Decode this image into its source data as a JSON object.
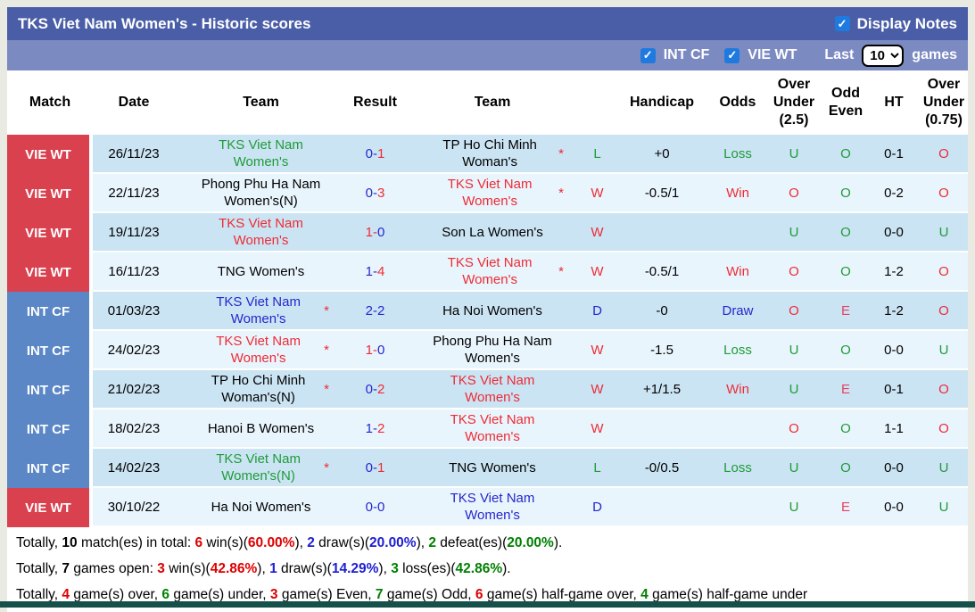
{
  "header": {
    "title": "TKS Viet Nam Women's - Historic scores",
    "display_notes_label": "Display Notes",
    "display_notes_checked": true,
    "filters": [
      {
        "label": "INT CF",
        "checked": true
      },
      {
        "label": "VIE WT",
        "checked": true
      }
    ],
    "last_label": "Last",
    "last_value": "10",
    "games_label": "games"
  },
  "table": {
    "columns": [
      "Match",
      "Date",
      "Team",
      "Result",
      "Team",
      "",
      "Handicap",
      "Odds",
      "Over Under (2.5)",
      "Odd Even",
      "HT",
      "Over Under (0.75)"
    ],
    "rows": [
      {
        "league": "VIE WT",
        "league_color": "red",
        "date": "26/11/23",
        "team1": {
          "name": "TKS Viet Nam Women's",
          "color": "green",
          "star": false
        },
        "result": {
          "home": "0",
          "away": "1",
          "home_color": "blue",
          "away_color": "red"
        },
        "team2": {
          "name": "TP Ho Chi Minh Woman's",
          "color": "black",
          "star": true
        },
        "outcome": {
          "value": "L",
          "color": "green"
        },
        "handicap": "+0",
        "odds": {
          "value": "Loss",
          "color": "green"
        },
        "over_under_25": {
          "value": "U",
          "color": "green"
        },
        "odd_even": {
          "value": "O",
          "color": "green"
        },
        "ht": "0-1",
        "over_under_075": {
          "value": "O",
          "color": "red"
        }
      },
      {
        "league": "VIE WT",
        "league_color": "red",
        "date": "22/11/23",
        "team1": {
          "name": "Phong Phu Ha Nam Women's(N)",
          "color": "black",
          "star": false
        },
        "result": {
          "home": "0",
          "away": "3",
          "home_color": "blue",
          "away_color": "red"
        },
        "team2": {
          "name": "TKS Viet Nam Women's",
          "color": "red",
          "star": true
        },
        "outcome": {
          "value": "W",
          "color": "red"
        },
        "handicap": "-0.5/1",
        "odds": {
          "value": "Win",
          "color": "red"
        },
        "over_under_25": {
          "value": "O",
          "color": "red"
        },
        "odd_even": {
          "value": "O",
          "color": "green"
        },
        "ht": "0-2",
        "over_under_075": {
          "value": "O",
          "color": "red"
        }
      },
      {
        "league": "VIE WT",
        "league_color": "red",
        "date": "19/11/23",
        "team1": {
          "name": "TKS Viet Nam Women's",
          "color": "red",
          "star": false
        },
        "result": {
          "home": "1",
          "away": "0",
          "home_color": "red",
          "away_color": "blue"
        },
        "team2": {
          "name": "Son La Women's",
          "color": "black",
          "star": false
        },
        "outcome": {
          "value": "W",
          "color": "red"
        },
        "handicap": "",
        "odds": {
          "value": "",
          "color": "black"
        },
        "over_under_25": {
          "value": "U",
          "color": "green"
        },
        "odd_even": {
          "value": "O",
          "color": "green"
        },
        "ht": "0-0",
        "over_under_075": {
          "value": "U",
          "color": "green"
        }
      },
      {
        "league": "VIE WT",
        "league_color": "red",
        "date": "16/11/23",
        "team1": {
          "name": "TNG Women's",
          "color": "black",
          "star": false
        },
        "result": {
          "home": "1",
          "away": "4",
          "home_color": "blue",
          "away_color": "red"
        },
        "team2": {
          "name": "TKS Viet Nam Women's",
          "color": "red",
          "star": true
        },
        "outcome": {
          "value": "W",
          "color": "red"
        },
        "handicap": "-0.5/1",
        "odds": {
          "value": "Win",
          "color": "red"
        },
        "over_under_25": {
          "value": "O",
          "color": "red"
        },
        "odd_even": {
          "value": "O",
          "color": "green"
        },
        "ht": "1-2",
        "over_under_075": {
          "value": "O",
          "color": "red"
        }
      },
      {
        "league": "INT CF",
        "league_color": "blue",
        "date": "01/03/23",
        "team1": {
          "name": "TKS Viet Nam Women's",
          "color": "blue",
          "star": true
        },
        "result": {
          "home": "2",
          "away": "2",
          "home_color": "blue",
          "away_color": "blue"
        },
        "team2": {
          "name": "Ha Noi Women's",
          "color": "black",
          "star": false
        },
        "outcome": {
          "value": "D",
          "color": "blue"
        },
        "handicap": "-0",
        "odds": {
          "value": "Draw",
          "color": "blue"
        },
        "over_under_25": {
          "value": "O",
          "color": "red"
        },
        "odd_even": {
          "value": "E",
          "color": "crimson"
        },
        "ht": "1-2",
        "over_under_075": {
          "value": "O",
          "color": "red"
        }
      },
      {
        "league": "INT CF",
        "league_color": "blue",
        "date": "24/02/23",
        "team1": {
          "name": "TKS Viet Nam Women's",
          "color": "red",
          "star": true
        },
        "result": {
          "home": "1",
          "away": "0",
          "home_color": "red",
          "away_color": "blue"
        },
        "team2": {
          "name": "Phong Phu Ha Nam Women's",
          "color": "black",
          "star": false
        },
        "outcome": {
          "value": "W",
          "color": "red"
        },
        "handicap": "-1.5",
        "odds": {
          "value": "Loss",
          "color": "green"
        },
        "over_under_25": {
          "value": "U",
          "color": "green"
        },
        "odd_even": {
          "value": "O",
          "color": "green"
        },
        "ht": "0-0",
        "over_under_075": {
          "value": "U",
          "color": "green"
        }
      },
      {
        "league": "INT CF",
        "league_color": "blue",
        "date": "21/02/23",
        "team1": {
          "name": "TP Ho Chi Minh Woman's(N)",
          "color": "black",
          "star": true
        },
        "result": {
          "home": "0",
          "away": "2",
          "home_color": "blue",
          "away_color": "red"
        },
        "team2": {
          "name": "TKS Viet Nam Women's",
          "color": "red",
          "star": false
        },
        "outcome": {
          "value": "W",
          "color": "red"
        },
        "handicap": "+1/1.5",
        "odds": {
          "value": "Win",
          "color": "red"
        },
        "over_under_25": {
          "value": "U",
          "color": "green"
        },
        "odd_even": {
          "value": "E",
          "color": "crimson"
        },
        "ht": "0-1",
        "over_under_075": {
          "value": "O",
          "color": "red"
        }
      },
      {
        "league": "INT CF",
        "league_color": "blue",
        "date": "18/02/23",
        "team1": {
          "name": "Hanoi B Women's",
          "color": "black",
          "star": false
        },
        "result": {
          "home": "1",
          "away": "2",
          "home_color": "blue",
          "away_color": "red"
        },
        "team2": {
          "name": "TKS Viet Nam Women's",
          "color": "red",
          "star": false
        },
        "outcome": {
          "value": "W",
          "color": "red"
        },
        "handicap": "",
        "odds": {
          "value": "",
          "color": "black"
        },
        "over_under_25": {
          "value": "O",
          "color": "red"
        },
        "odd_even": {
          "value": "O",
          "color": "green"
        },
        "ht": "1-1",
        "over_under_075": {
          "value": "O",
          "color": "red"
        }
      },
      {
        "league": "INT CF",
        "league_color": "blue",
        "date": "14/02/23",
        "team1": {
          "name": "TKS Viet Nam Women's(N)",
          "color": "green",
          "star": true
        },
        "result": {
          "home": "0",
          "away": "1",
          "home_color": "blue",
          "away_color": "red"
        },
        "team2": {
          "name": "TNG Women's",
          "color": "black",
          "star": false
        },
        "outcome": {
          "value": "L",
          "color": "green"
        },
        "handicap": "-0/0.5",
        "odds": {
          "value": "Loss",
          "color": "green"
        },
        "over_under_25": {
          "value": "U",
          "color": "green"
        },
        "odd_even": {
          "value": "O",
          "color": "green"
        },
        "ht": "0-0",
        "over_under_075": {
          "value": "U",
          "color": "green"
        }
      },
      {
        "league": "VIE WT",
        "league_color": "red",
        "date": "30/10/22",
        "team1": {
          "name": "Ha Noi Women's",
          "color": "black",
          "star": false
        },
        "result": {
          "home": "0",
          "away": "0",
          "home_color": "blue",
          "away_color": "blue"
        },
        "team2": {
          "name": "TKS Viet Nam Women's",
          "color": "blue",
          "star": false
        },
        "outcome": {
          "value": "D",
          "color": "blue"
        },
        "handicap": "",
        "odds": {
          "value": "",
          "color": "black"
        },
        "over_under_25": {
          "value": "U",
          "color": "green"
        },
        "odd_even": {
          "value": "E",
          "color": "crimson"
        },
        "ht": "0-0",
        "over_under_075": {
          "value": "U",
          "color": "green"
        }
      }
    ]
  },
  "summary": {
    "lines": [
      [
        {
          "text": "Totally, "
        },
        {
          "text": "10",
          "bold": true
        },
        {
          "text": " match(es) in total: "
        },
        {
          "text": "6",
          "color": "red",
          "bold": true
        },
        {
          "text": " win(s)("
        },
        {
          "text": "60.00%",
          "color": "red",
          "bold": true
        },
        {
          "text": "), "
        },
        {
          "text": "2",
          "color": "blue",
          "bold": true
        },
        {
          "text": " draw(s)("
        },
        {
          "text": "20.00%",
          "color": "blue",
          "bold": true
        },
        {
          "text": "), "
        },
        {
          "text": "2",
          "color": "green",
          "bold": true
        },
        {
          "text": " defeat(es)("
        },
        {
          "text": "20.00%",
          "color": "green",
          "bold": true
        },
        {
          "text": ")."
        }
      ],
      [
        {
          "text": "Totally, "
        },
        {
          "text": "7",
          "bold": true
        },
        {
          "text": " games open: "
        },
        {
          "text": "3",
          "color": "red",
          "bold": true
        },
        {
          "text": " win(s)("
        },
        {
          "text": "42.86%",
          "color": "red",
          "bold": true
        },
        {
          "text": "), "
        },
        {
          "text": "1",
          "color": "blue",
          "bold": true
        },
        {
          "text": " draw(s)("
        },
        {
          "text": "14.29%",
          "color": "blue",
          "bold": true
        },
        {
          "text": "), "
        },
        {
          "text": "3",
          "color": "green",
          "bold": true
        },
        {
          "text": " loss(es)("
        },
        {
          "text": "42.86%",
          "color": "green",
          "bold": true
        },
        {
          "text": ")."
        }
      ],
      [
        {
          "text": "Totally, "
        },
        {
          "text": "4",
          "color": "red",
          "bold": true
        },
        {
          "text": " game(s) over, "
        },
        {
          "text": "6",
          "color": "green",
          "bold": true
        },
        {
          "text": " game(s) under, "
        },
        {
          "text": "3",
          "color": "red",
          "bold": true
        },
        {
          "text": " game(s) Even, "
        },
        {
          "text": "7",
          "color": "green",
          "bold": true
        },
        {
          "text": " game(s) Odd, "
        },
        {
          "text": "6",
          "color": "red",
          "bold": true
        },
        {
          "text": " game(s) half-game over, "
        },
        {
          "text": "4",
          "color": "green",
          "bold": true
        },
        {
          "text": " game(s) half-game under"
        }
      ]
    ]
  },
  "colors": {
    "title_bar_bg": "#4a5ea7",
    "filter_bar_bg": "#7c8ac2",
    "checkbox_blue": "#1f7ae0",
    "badge_red": "#d9414f",
    "badge_blue": "#5b87c6",
    "row_odd_bg": "#cbe4f3",
    "row_even_bg": "#e9f5fc",
    "red": "#ee2b35",
    "green": "#1f9b38",
    "blue": "#2527cd",
    "crimson": "#e8415f",
    "black": "#000000",
    "summary_red": "#dd0000",
    "summary_green": "#008000",
    "summary_blue": "#1d1dd4",
    "footer_bar": "#15514a"
  }
}
